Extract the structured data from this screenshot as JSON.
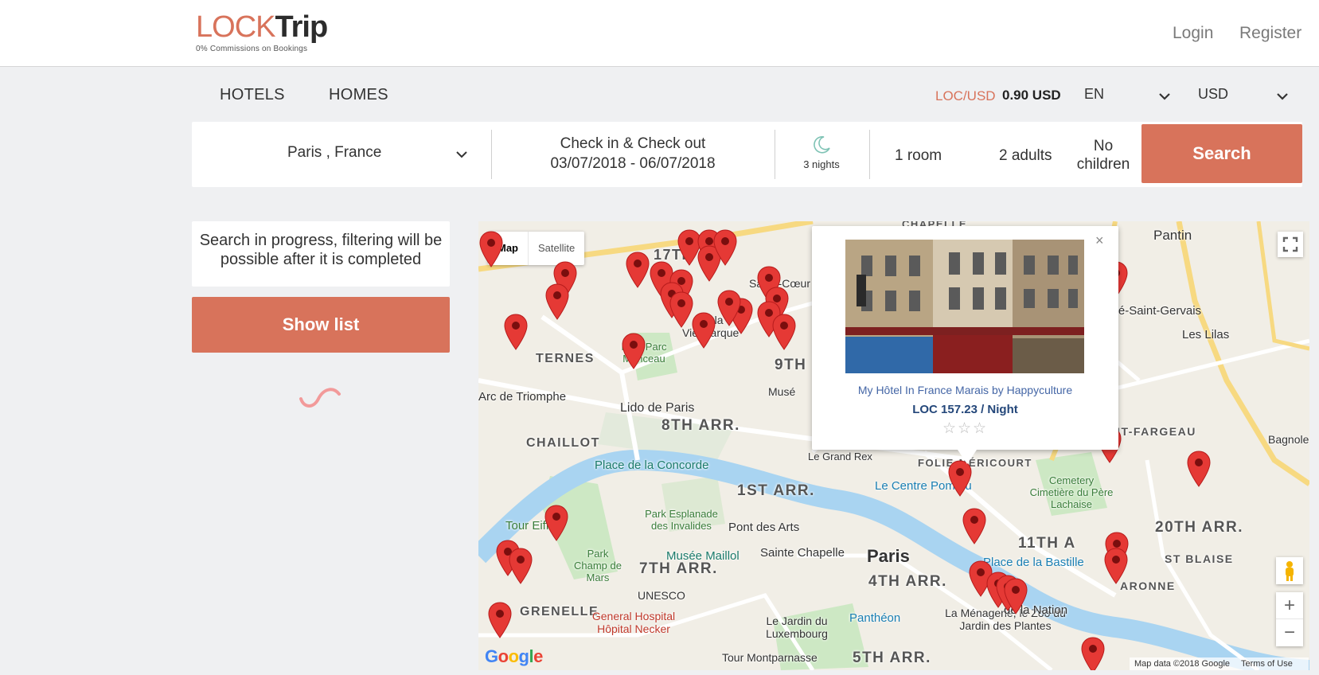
{
  "header": {
    "logo_lock": "LOCK",
    "logo_trip": "Trip",
    "tagline": "0% Commissions on Bookings",
    "login": "Login",
    "register": "Register"
  },
  "nav": {
    "tabs": [
      "HOTELS",
      "HOMES"
    ],
    "rate_label": "LOC/USD",
    "rate_value": "0.90 USD",
    "language": "EN",
    "currency": "USD"
  },
  "search": {
    "destination": "Paris , France",
    "dates_label": "Check in & Check out",
    "dates_value": "03/07/2018 - 06/07/2018",
    "nights": "3 nights",
    "rooms": "1 room",
    "adults": "2 adults",
    "children": "No children",
    "button": "Search"
  },
  "sidebar": {
    "progress_text": "Search in progress, filtering will be possible after it is completed",
    "show_list": "Show list"
  },
  "map": {
    "type_map": "Map",
    "type_satellite": "Satellite",
    "zoom_in": "+",
    "zoom_out": "−",
    "logo": "Google",
    "credits": "Map data ©2018 Google",
    "terms": "Terms of Use",
    "labels": {
      "l1": "TERNES",
      "l2": "8TH ARR.",
      "l3": "CHAILLOT",
      "l4": "1ST ARR.",
      "l5": "7TH ARR.",
      "l6": "Paris",
      "l7": "4TH ARR.",
      "l8": "11TH A",
      "l9": "20TH ARR.",
      "l10": "GRENELLE",
      "l11": "9TH",
      "l12": "Lido de Paris",
      "l13": "Arc de Triomphe",
      "l14": "Place de la Concorde",
      "l15": "Tour Eiffel",
      "l16": "Park Champ de Mars",
      "l17": "Park Esplanade des Invalides",
      "l18": "Musée Maillol",
      "l19": "Pont des Arts",
      "l20": "Sainte Chapelle",
      "l21": "Le Centre Pom   ou",
      "l22": "Place de la Bastille",
      "l23": "Cemetery Cimetière du Père Lachaise",
      "l24": "UNESCO",
      "l25": "General Hospital Hôpital Necker",
      "l26": "Le Jardin du Luxembourg",
      "l27": "Panthéon",
      "l28": "La Ménagerie, le Zoo du Jardin des Plantes",
      "l29": "Tour Montparnasse",
      "l30": "5TH ARR.",
      "l31": "Pantin",
      "l32": "Le Pré-Saint-Gervais",
      "l33": "Les Lilas",
      "l34": "SAINT-FARGEAU",
      "l35": "Bagnole",
      "l36": "ST BLAISE",
      "l37": "ARONNE",
      "l38": "de la Nation",
      "l39": "Park Parc Monceau",
      "l40": "Le Grand Rex",
      "l41": "FOLIE-MÉRICOURT",
      "l42": "Musé",
      "l43": "CHAPELLE",
      "l44": "Sacré-Cœur",
      "l45": "17TH AR.",
      "l46": "Vie marque",
      "l47": "se la"
    }
  },
  "popup": {
    "hotel_name": "My Hôtel In France Marais by Happyculture",
    "price": "LOC 157.23 / Night",
    "stars": "☆☆☆",
    "close": "×"
  },
  "colors": {
    "accent": "#d8735b",
    "pin": "#e53935",
    "price": "#24477a",
    "hotel_link": "#4466a6"
  }
}
